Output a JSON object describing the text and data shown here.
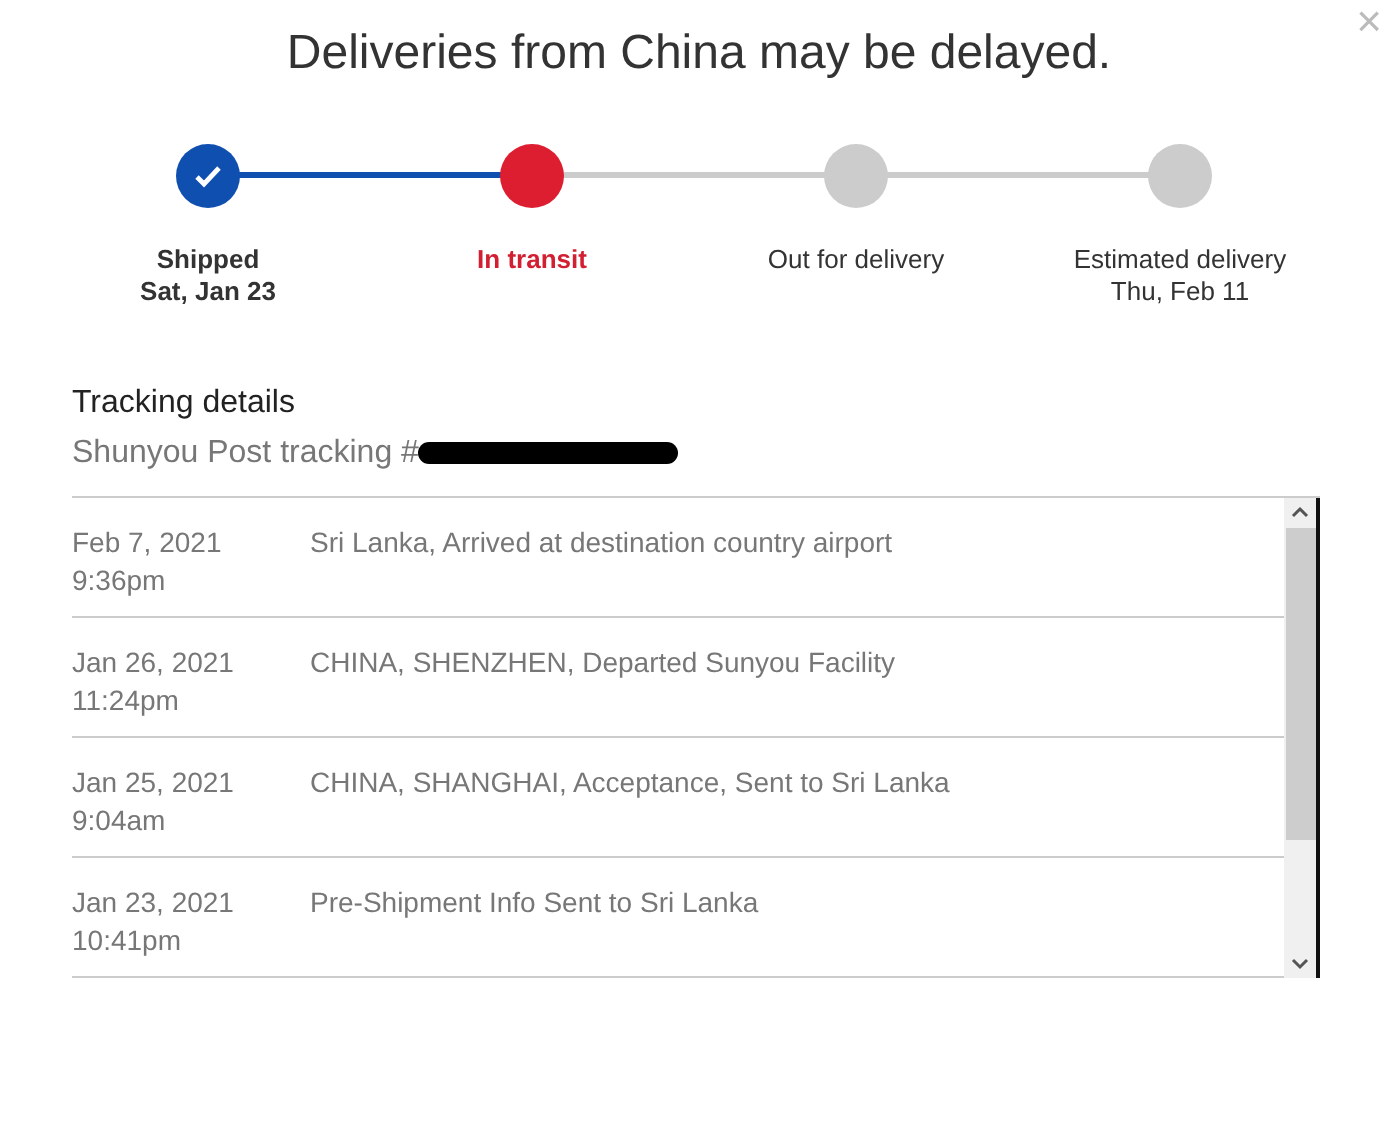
{
  "close": {
    "symbol": "×"
  },
  "title": "Deliveries from China may be delayed.",
  "steps": [
    {
      "label": "Shipped",
      "date": "Sat, Jan 23",
      "completed": true,
      "selected": false
    },
    {
      "label": "In transit",
      "completed": false,
      "selected": true
    },
    {
      "label": "Out for delivery",
      "completed": false,
      "selected": false
    },
    {
      "label": "Estimated delivery",
      "date": "Thu, Feb 11",
      "completed": false,
      "selected": false
    }
  ],
  "tracking": {
    "heading": "Tracking details",
    "carrier_line": "Shunyou Post tracking #",
    "number_redacted": true
  },
  "events": [
    {
      "date": "Feb 7, 2021",
      "time": "9:36pm",
      "description": "Sri Lanka, Arrived at destination country airport"
    },
    {
      "date": "Jan 26, 2021",
      "time": "11:24pm",
      "description": "CHINA, SHENZHEN, Departed Sunyou Facility"
    },
    {
      "date": "Jan 25, 2021",
      "time": "9:04am",
      "description": "CHINA, SHANGHAI, Acceptance, Sent to Sri Lanka"
    },
    {
      "date": "Jan 23, 2021",
      "time": "10:41pm",
      "description": "Pre-Shipment Info Sent to Sri Lanka"
    }
  ]
}
